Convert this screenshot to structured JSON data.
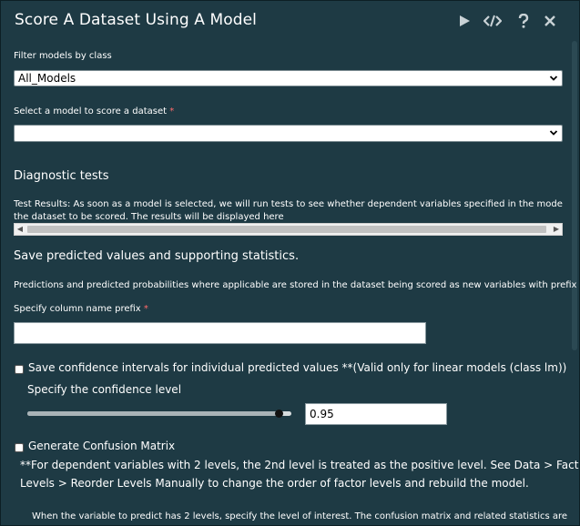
{
  "window": {
    "title": "Score A Dataset Using A Model",
    "icons": [
      "play-icon",
      "code-icon",
      "help-icon",
      "close-icon"
    ]
  },
  "filter": {
    "label": "Filter models by class",
    "value": "All_Models"
  },
  "model_select": {
    "label": "Select a model to score a dataset",
    "required_mark": "*",
    "value": ""
  },
  "diagnostics": {
    "heading": "Diagnostic tests",
    "line1": "Test Results: As soon as a model is selected, we will run tests to see whether dependent variables specified in the model are availab",
    "line2": "the dataset to be scored. The results will be displayed here"
  },
  "save": {
    "heading": "Save predicted values and supporting statistics.",
    "description": "Predictions and predicted probabilities where applicable are stored in the dataset being scored as new variables with prefix below",
    "prefix_label": "Specify column name prefix",
    "required_mark": "*",
    "prefix_value": ""
  },
  "confidence": {
    "checkbox_label": "Save confidence intervals for individual predicted values **(Valid only for linear models (class lm))",
    "checked": false,
    "level_label": "Specify the confidence level",
    "level_value": "0.95",
    "slider_fraction": 0.95
  },
  "confusion": {
    "checkbox_label": "Generate Confusion Matrix",
    "checked": false,
    "note_line1": "**For dependent variables with 2 levels, the 2nd level is treated as the positive level. See Data > Factor",
    "note_line2": "Levels > Reorder Levels Manually to change the order of factor levels and rebuild the model.",
    "interest_text": "When the variable to predict has 2 levels, specify the level of interest. The confusion matrix and related statistics are"
  },
  "colors": {
    "background": "#1e3a44",
    "required": "#ff6b6b"
  }
}
